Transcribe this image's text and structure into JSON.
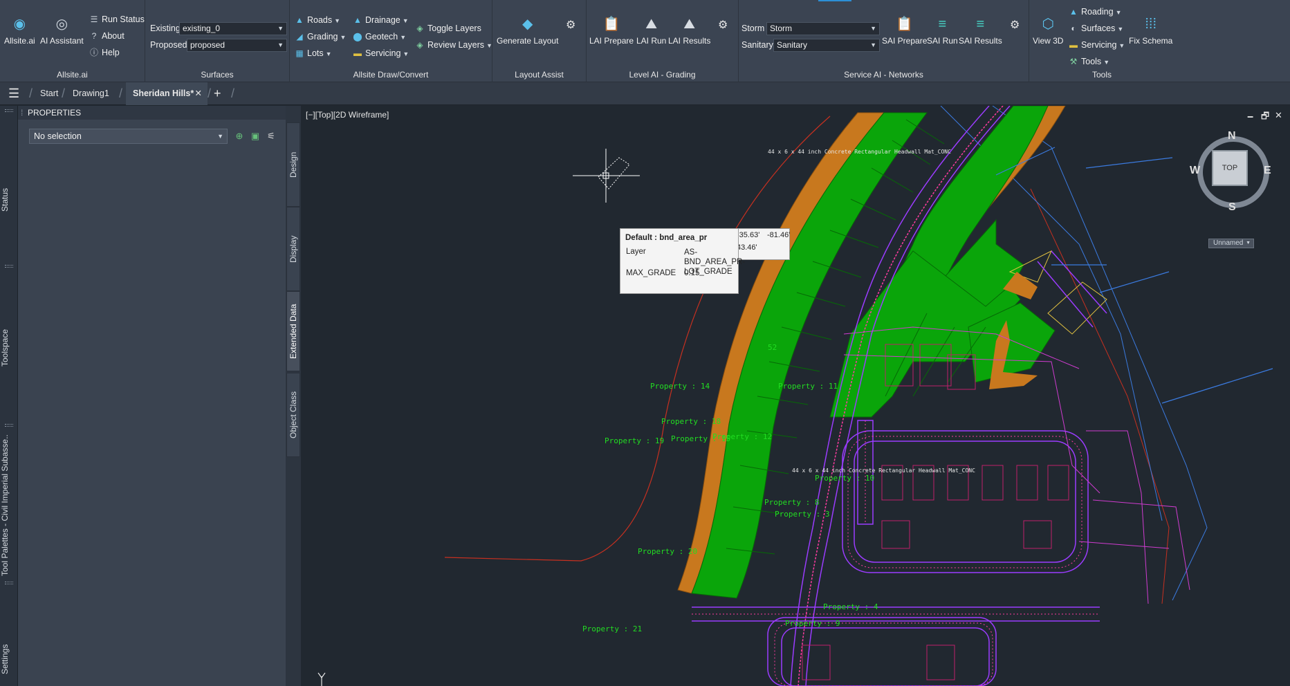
{
  "ribbon": {
    "allsite": {
      "title": "Allsite.ai",
      "app_label": "Allsite.ai",
      "assistant_label": "AI Assistant",
      "run_status": "Run Status",
      "about": "About",
      "help": "Help"
    },
    "surfaces": {
      "title": "Surfaces",
      "existing_label": "Existing",
      "existing_value": "existing_0",
      "proposed_label": "Proposed",
      "proposed_value": "proposed"
    },
    "draw": {
      "title": "Allsite Draw/Convert",
      "roads": "Roads",
      "grading": "Grading",
      "lots": "Lots",
      "drainage": "Drainage",
      "geotech": "Geotech",
      "servicing": "Servicing",
      "toggle_layers": "Toggle Layers",
      "review_layers": "Review Layers"
    },
    "layout": {
      "title": "Layout Assist",
      "generate": "Generate Layout"
    },
    "level": {
      "title": "Level AI - Grading",
      "prepare": "LAI Prepare",
      "run": "LAI Run",
      "results": "LAI Results"
    },
    "service": {
      "title": "Service AI - Networks",
      "storm_label": "Storm",
      "storm_value": "Storm",
      "sanitary_label": "Sanitary",
      "sanitary_value": "Sanitary",
      "prepare": "SAI Prepare",
      "run": "SAI Run",
      "results": "SAI Results"
    },
    "tools": {
      "title": "Tools",
      "view3d": "View 3D",
      "roading": "Roading",
      "surfaces": "Surfaces",
      "servicing": "Servicing",
      "tools": "Tools",
      "fix_schema": "Fix Schema"
    }
  },
  "tabs": {
    "start": "Start",
    "drawing1": "Drawing1",
    "sheridan": "Sheridan Hills*"
  },
  "left_strip": {
    "status": "Status",
    "toolspace": "Toolspace",
    "tool_palettes": "Tool Palettes - Civil Imperial Subasse...",
    "settings": "Settings"
  },
  "properties": {
    "title": "PROPERTIES",
    "selection": "No selection"
  },
  "side_tabs": {
    "design": "Design",
    "display": "Display",
    "extended": "Extended Data",
    "object_class": "Object Class"
  },
  "viewport": {
    "label": "[−][Top][2D Wireframe]",
    "compass": {
      "n": "N",
      "s": "S",
      "e": "E",
      "w": "W",
      "top": "TOP"
    },
    "ucs": "Unnamed",
    "tooltip": {
      "title": "Default : bnd_area_pr",
      "layer_key": "Layer",
      "layer_val": "AS-BND_AREA_PR-LOT_GRADE",
      "grade_key": "MAX_GRADE",
      "grade_val": "0.15",
      "coord1": "-35.63'",
      "coord2": "-81.46'",
      "coord3": "43.46'"
    },
    "annotations": {
      "headwall1": "44 x 6 x 44 inch Concrete Rectangular Headwall Mat_CONC",
      "headwall2": "44 x 6 x 44 inch Concrete Rectangular Headwall Mat_CONC"
    },
    "lot_labels": [
      {
        "text": "Property : 14"
      },
      {
        "text": "Property : 11"
      },
      {
        "text": "Property : 18"
      },
      {
        "text": "Property : 15"
      },
      {
        "text": "Property : 12"
      },
      {
        "text": "Property : 19"
      },
      {
        "text": "Property : 10"
      },
      {
        "text": "Property : 8"
      },
      {
        "text": "Property : 3"
      },
      {
        "text": "Property : 20"
      },
      {
        "text": "Property : 4"
      },
      {
        "text": "Property : 9"
      },
      {
        "text": "Property : 21"
      },
      {
        "text": "52"
      }
    ]
  },
  "colors": {
    "lot_fill": "#0aa50a",
    "buffer": "#c8781e",
    "road": "#9b3cff",
    "sidewalk": "#ff3ca0",
    "accent": "#5bc0ea"
  }
}
